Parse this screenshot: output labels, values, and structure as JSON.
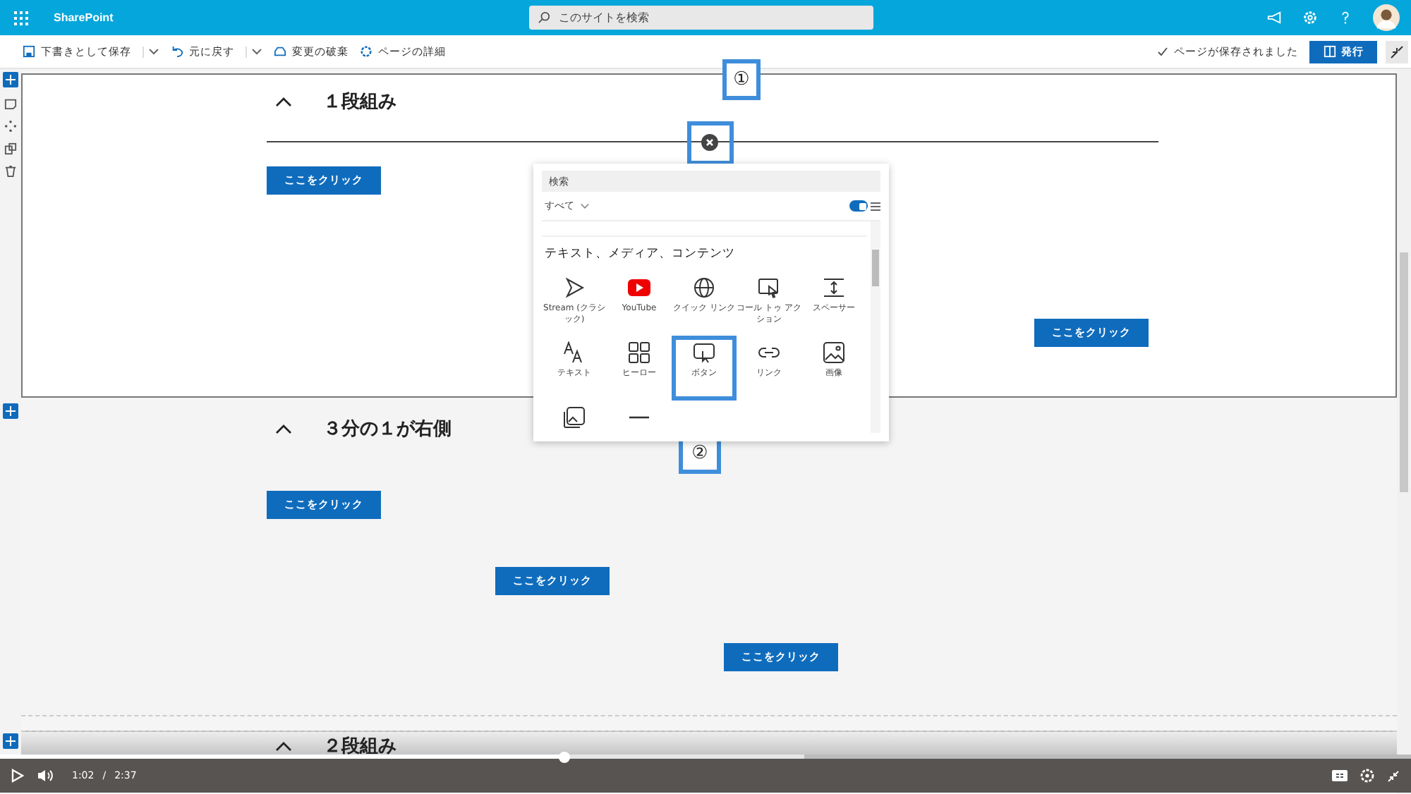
{
  "app_bar": {
    "title": "SharePoint",
    "search_placeholder": "このサイトを検索"
  },
  "command_bar": {
    "items": [
      {
        "label": "下書きとして保存",
        "kind": "save",
        "dropdown": true
      },
      {
        "label": "元に戻す",
        "kind": "undo",
        "dropdown": true
      },
      {
        "label": "変更の破棄",
        "kind": "discard",
        "dropdown": false
      },
      {
        "label": "ページの詳細",
        "kind": "details",
        "dropdown": false
      }
    ],
    "status": "ページが保存されました",
    "publish": "発行"
  },
  "sections": [
    {
      "title": "１段組み",
      "selected": true,
      "buttons": [
        "ここをクリック",
        "ここをクリック"
      ]
    },
    {
      "title": "３分の１が右側",
      "selected": false,
      "buttons": [
        "ここをクリック",
        "ここをクリック",
        "ここをクリック"
      ]
    },
    {
      "title": "２段組み",
      "selected": false
    }
  ],
  "toolbox": {
    "search_placeholder": "検索",
    "filter": "すべて",
    "grid_view": true,
    "heading": "テキスト、メディア、コンテンツ",
    "items": [
      {
        "label": "Stream (クラシック)",
        "kind": "stream",
        "highlighted": false
      },
      {
        "label": "YouTube",
        "kind": "youtube",
        "highlighted": false
      },
      {
        "label": "クイック リンク",
        "kind": "globe",
        "highlighted": false
      },
      {
        "label": "コール トゥ アクション",
        "kind": "cta",
        "highlighted": false
      },
      {
        "label": "スペーサー",
        "kind": "spacer",
        "highlighted": false
      },
      {
        "label": "テキスト",
        "kind": "text",
        "highlighted": false
      },
      {
        "label": "ヒーロー",
        "kind": "hero",
        "highlighted": false
      },
      {
        "label": "ボタン",
        "kind": "button",
        "highlighted": true
      },
      {
        "label": "リンク",
        "kind": "link",
        "highlighted": false
      },
      {
        "label": "画像",
        "kind": "image",
        "highlighted": false
      },
      {
        "kind": "gallery",
        "highlighted": false
      },
      {
        "kind": "divider",
        "highlighted": false
      }
    ]
  },
  "callouts": [
    "①",
    "②"
  ],
  "video_player": {
    "current_time": "1:02",
    "separator": "/",
    "duration": "2:37",
    "level": 0.4
  }
}
